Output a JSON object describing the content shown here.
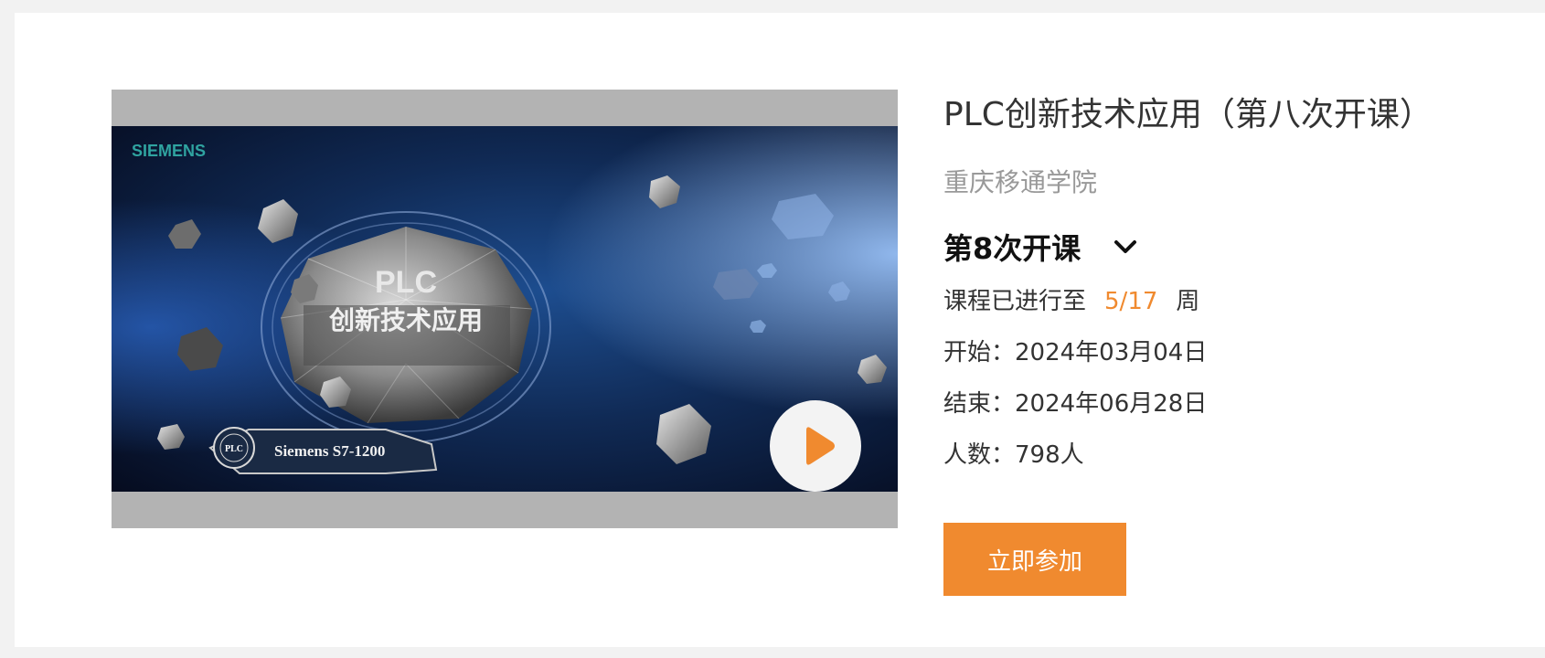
{
  "course": {
    "title": "PLC创新技术应用（第八次开课）",
    "school": "重庆移通学院",
    "session": {
      "selected": "第8次开课",
      "icon": "chevron-down-icon"
    },
    "progress": {
      "label": "课程已进行至",
      "value": "5/17",
      "unit": "周"
    },
    "start": {
      "label": "开始：",
      "value": "2024年03月04日"
    },
    "end": {
      "label": "结束：",
      "value": "2024年06月28日"
    },
    "count": {
      "label": "人数：",
      "value": "798人"
    },
    "join_label": "立即参加"
  },
  "cover": {
    "brand": "SIEMENS",
    "badge_line1": "PLC",
    "badge_line2": "创新技术应用",
    "product": "Siemens S7-1200",
    "plc_mark": "PLC",
    "play_icon": "play-icon"
  },
  "colors": {
    "accent": "#f08a2f",
    "title": "#333333",
    "muted": "#999999",
    "background": "#f2f2f2",
    "card": "#ffffff",
    "cover_frame": "#b3b3b3"
  }
}
